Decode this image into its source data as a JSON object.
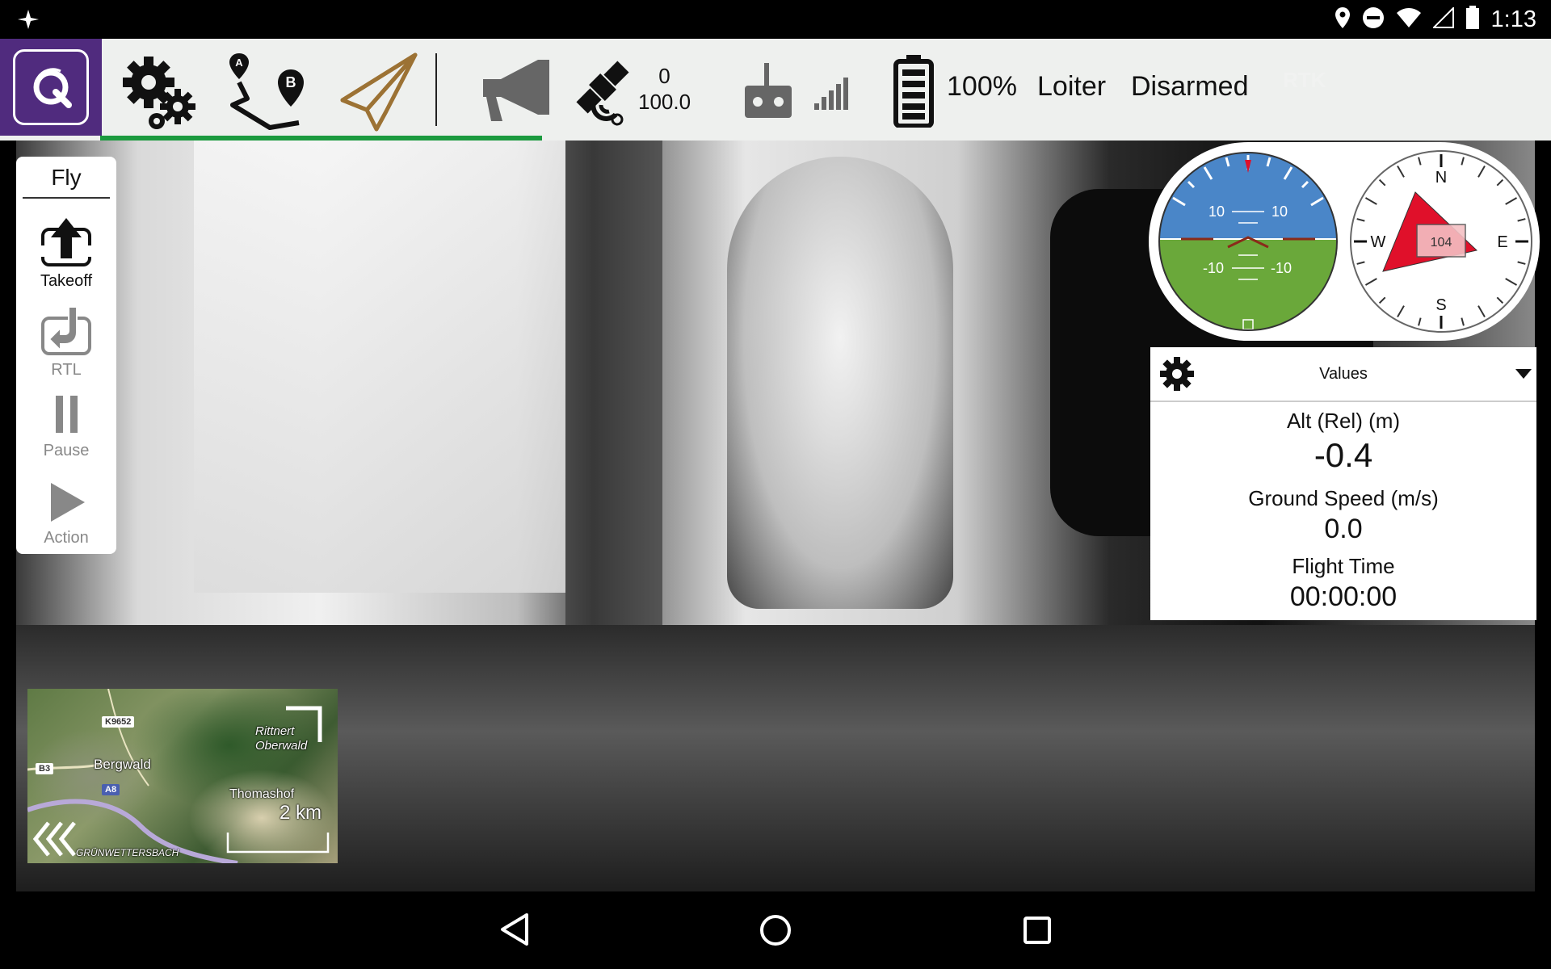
{
  "status_bar": {
    "time": "1:13",
    "icons": [
      "app-notification-icon",
      "location-icon",
      "do-not-disturb-icon",
      "wifi-icon",
      "cellular-icon",
      "battery-icon"
    ]
  },
  "toolbar": {
    "icons": [
      "qgc-logo-icon",
      "settings-gears-icon",
      "plan-route-icon",
      "fly-paper-plane-icon",
      "megaphone-icon",
      "gps-satellite-icon",
      "rc-transmitter-icon",
      "signal-strength-icon",
      "battery-icon"
    ],
    "gps_satellites": "0",
    "gps_hdop": "100.0",
    "battery_percent": "100%",
    "flight_mode": "Loiter",
    "arm_state": "Disarmed",
    "rtk_label": "RTK",
    "progress": 0.31
  },
  "fly_panel": {
    "title": "Fly",
    "buttons": [
      {
        "label": "Takeoff",
        "enabled": true
      },
      {
        "label": "RTL",
        "enabled": false
      },
      {
        "label": "Pause",
        "enabled": false
      },
      {
        "label": "Action",
        "enabled": false
      }
    ]
  },
  "attitude": {
    "pitch_labels": [
      "10",
      "10",
      "-10",
      "-10"
    ]
  },
  "compass": {
    "heading": "104",
    "north": "N",
    "south": "S",
    "east": "E",
    "west": "W"
  },
  "values": {
    "header": "Values",
    "items": [
      {
        "label": "Alt (Rel) (m)",
        "value": "-0.4"
      },
      {
        "label": "Ground Speed (m/s)",
        "value": "0.0"
      },
      {
        "label": "Flight Time",
        "value": "00:00:00"
      }
    ]
  },
  "minimap": {
    "scale": "2 km",
    "places": [
      "Bergwald",
      "Rittnert Oberwald",
      "Thomashof",
      "GRÜNWETTERSBACH"
    ],
    "roads": [
      "K9652",
      "B3",
      "A8"
    ]
  },
  "colors": {
    "brand_purple": "#502b7e",
    "progress_green": "#1b9a3e",
    "sky": "#4a86c8",
    "ground": "#6aa83a",
    "heading_red": "#e0102a"
  }
}
